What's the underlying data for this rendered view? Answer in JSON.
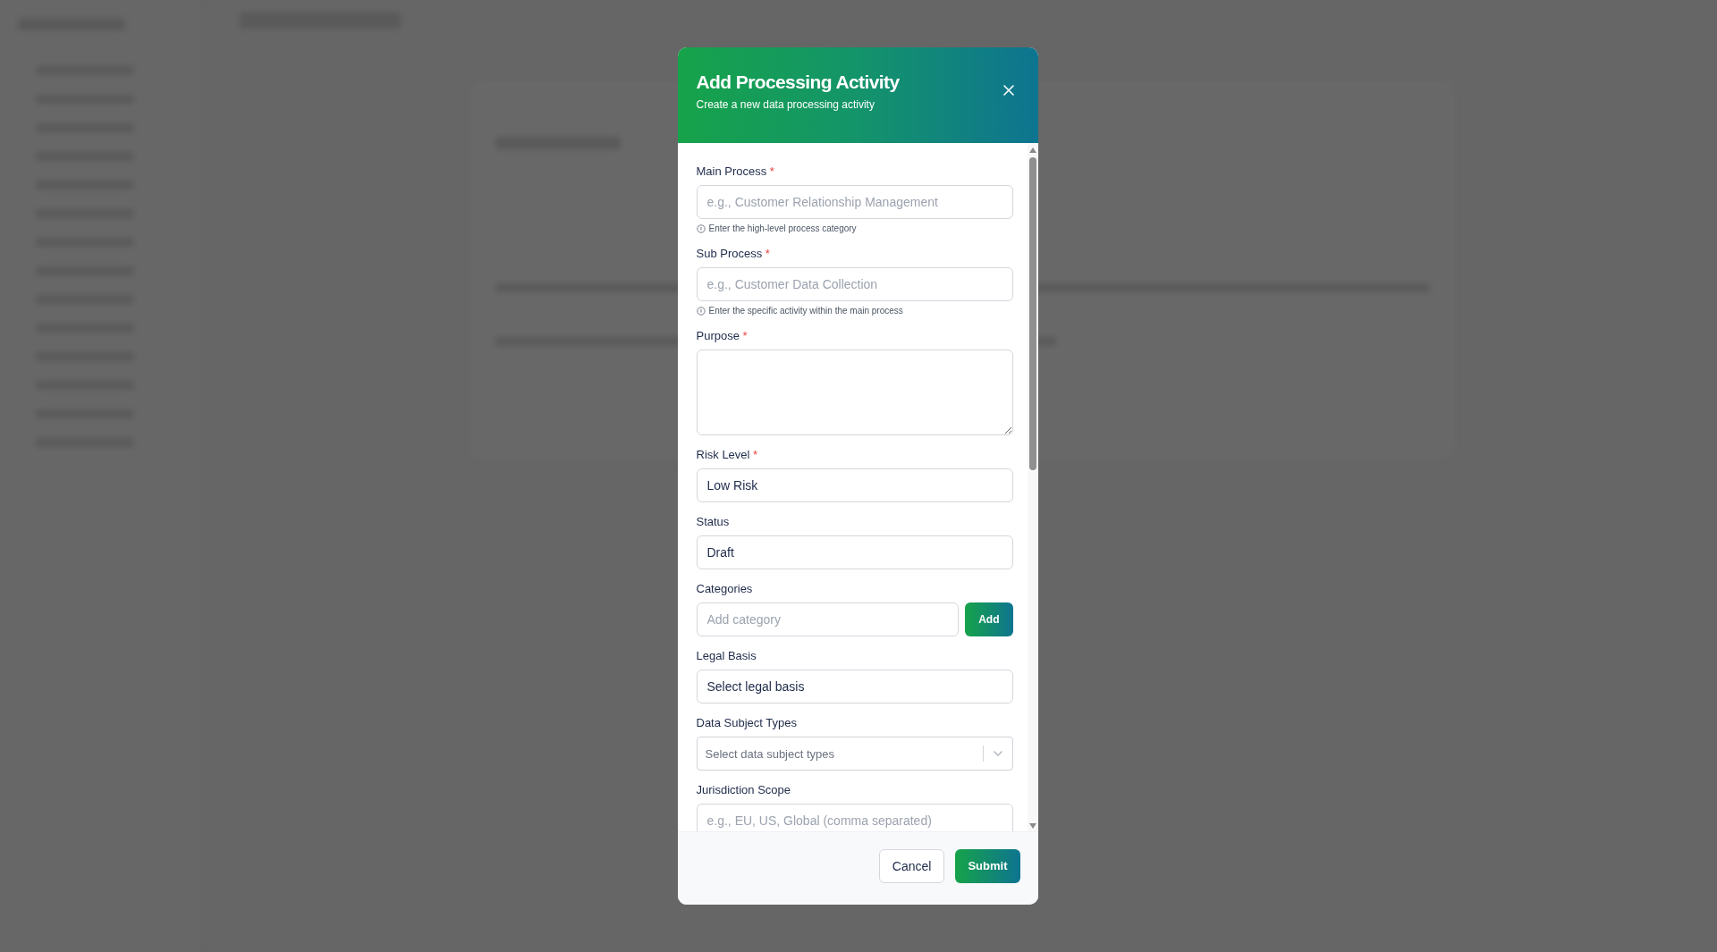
{
  "dialog": {
    "title": "Add Processing Activity",
    "subtitle": "Create a new data processing activity",
    "required_mark": "*",
    "fields": [
      {
        "kind": "text",
        "label": "Main Process",
        "required": true,
        "placeholder": "e.g., Customer Relationship Management",
        "hint": "Enter the high-level process category"
      },
      {
        "kind": "text",
        "label": "Sub Process",
        "required": true,
        "placeholder": "e.g., Customer Data Collection",
        "hint": "Enter the specific activity within the main process"
      },
      {
        "kind": "textarea",
        "label": "Purpose",
        "required": true
      },
      {
        "kind": "select",
        "label": "Risk Level",
        "required": true,
        "value": "Low Risk"
      },
      {
        "kind": "select",
        "label": "Status",
        "required": false,
        "value": "Draft"
      },
      {
        "kind": "add",
        "label": "Categories",
        "required": false,
        "placeholder": "Add category",
        "button": "Add"
      },
      {
        "kind": "select",
        "label": "Legal Basis",
        "required": false,
        "value": "Select legal basis"
      },
      {
        "kind": "multiselect",
        "label": "Data Subject Types",
        "required": false,
        "placeholder": "Select data subject types"
      },
      {
        "kind": "text",
        "label": "Jurisdiction Scope",
        "required": false,
        "placeholder": "e.g., EU, US, Global (comma separated)"
      }
    ],
    "buttons": [
      {
        "label": "Cancel",
        "kind": "secondary"
      },
      {
        "label": "Submit",
        "kind": "primary"
      }
    ]
  }
}
